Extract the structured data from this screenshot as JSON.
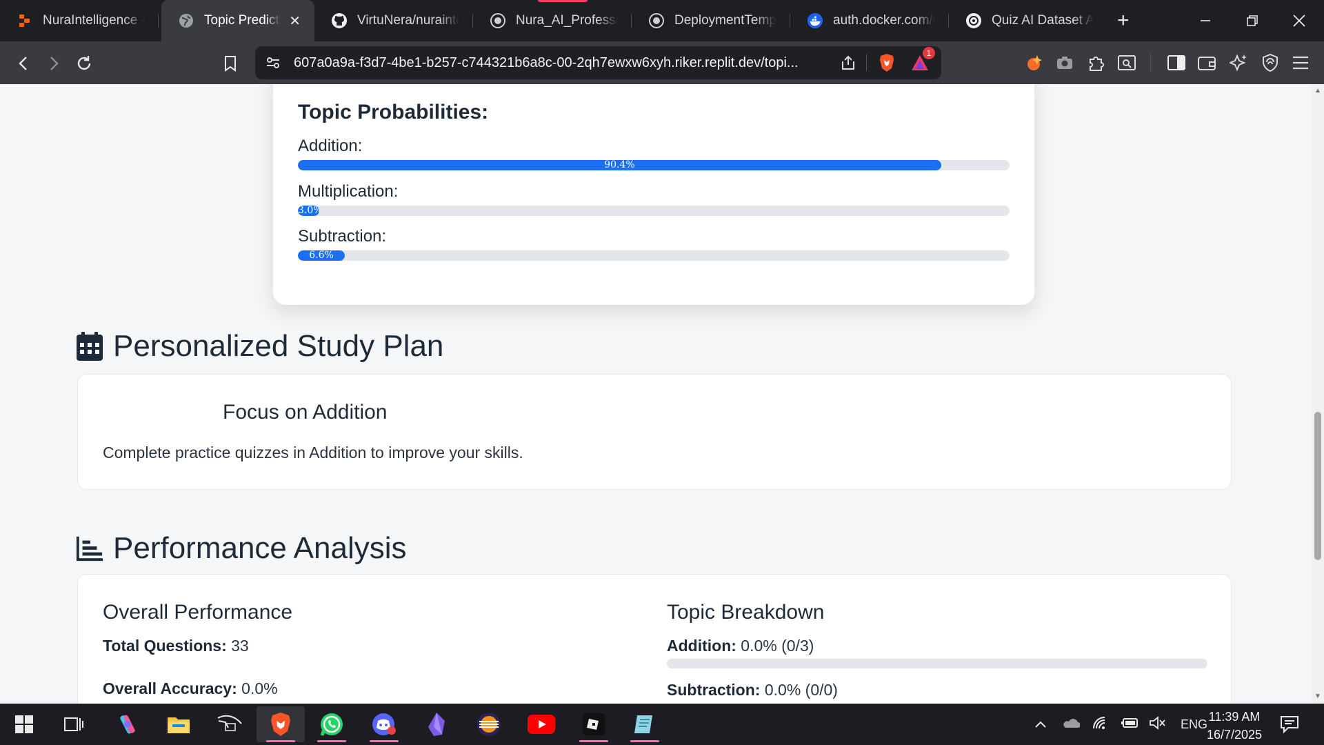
{
  "browser": {
    "tabs": [
      {
        "title": "NuraIntelligence - F",
        "icon": "replit-icon",
        "active": false
      },
      {
        "title": "Topic Predictio",
        "icon": "globe-icon",
        "active": true
      },
      {
        "title": "VirtuNera/nurainte",
        "icon": "github-icon",
        "active": false
      },
      {
        "title": "Nura_AI_Profession",
        "icon": "globe-icon",
        "active": false
      },
      {
        "title": "DeploymentTempla",
        "icon": "globe-icon",
        "active": false
      },
      {
        "title": "auth.docker.com/d",
        "icon": "docker-icon",
        "active": false
      },
      {
        "title": "Quiz AI Dataset An",
        "icon": "openai-icon",
        "active": false
      }
    ],
    "close_tab_symbol": "✕",
    "new_tab_symbol": "+",
    "url": "607a0a9a-f3d7-4be1-b257-c744321b6a8c-00-2qh7ewxw6xyh.riker.replit.dev/topi...",
    "rewards_badge": "1"
  },
  "topic_probabilities": {
    "title": "Topic Probabilities:",
    "items": [
      {
        "label": "Addition:",
        "percent": 90.4,
        "text": "90.4%"
      },
      {
        "label": "Multiplication:",
        "percent": 3.0,
        "text": "3.0%"
      },
      {
        "label": "Subtraction:",
        "percent": 6.6,
        "text": "6.6%"
      }
    ]
  },
  "study_plan": {
    "heading": "Personalized Study Plan",
    "title": "Focus on Addition",
    "description": "Complete practice quizzes in Addition to improve your skills."
  },
  "performance": {
    "heading": "Performance Analysis",
    "overall": {
      "title": "Overall Performance",
      "total_questions_label": "Total Questions:",
      "total_questions_value": "33",
      "accuracy_label": "Overall Accuracy:",
      "accuracy_value": "0.0%"
    },
    "breakdown": {
      "title": "Topic Breakdown",
      "items": [
        {
          "label": "Addition:",
          "value": "0.0% (0/3)",
          "percent": 0
        },
        {
          "label": "Subtraction:",
          "value": "0.0% (0/0)",
          "percent": 0
        }
      ]
    }
  },
  "taskbar": {
    "language": "ENG",
    "time": "11:39 AM",
    "date": "16/7/2025"
  },
  "colors": {
    "accent": "#1a6ff5",
    "brave_orange": "#fb542b"
  }
}
